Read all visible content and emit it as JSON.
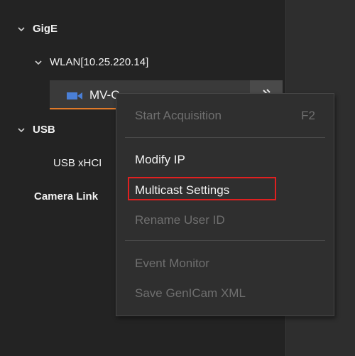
{
  "tree": {
    "gige": {
      "label": "GigE"
    },
    "wlan": {
      "label": "WLAN[10.25.220.14]"
    },
    "device": {
      "label": "MV-C"
    },
    "usb": {
      "label": "USB"
    },
    "usb_xhci": {
      "label": "USB xHCI"
    },
    "camera_link": {
      "label": "Camera Link"
    }
  },
  "context_menu": {
    "items": [
      {
        "label": "Start Acquisition",
        "shortcut": "F2",
        "enabled": false
      },
      {
        "label": "Modify IP",
        "enabled": true
      },
      {
        "label": "Multicast Settings",
        "enabled": true,
        "highlighted": true
      },
      {
        "label": "Rename User ID",
        "enabled": false
      },
      {
        "label": "Event Monitor",
        "enabled": false
      },
      {
        "label": "Save GenICam XML",
        "enabled": false
      }
    ]
  },
  "icons": {
    "chevron": "chevron-down-icon",
    "camera": "camera-icon",
    "settings": "settings-icon"
  },
  "colors": {
    "panel_bg": "#232323",
    "menu_bg": "#2f2f2f",
    "highlight_border": "#e02020",
    "device_accent": "#e07a2a",
    "camera_icon": "#4a7fd6"
  }
}
